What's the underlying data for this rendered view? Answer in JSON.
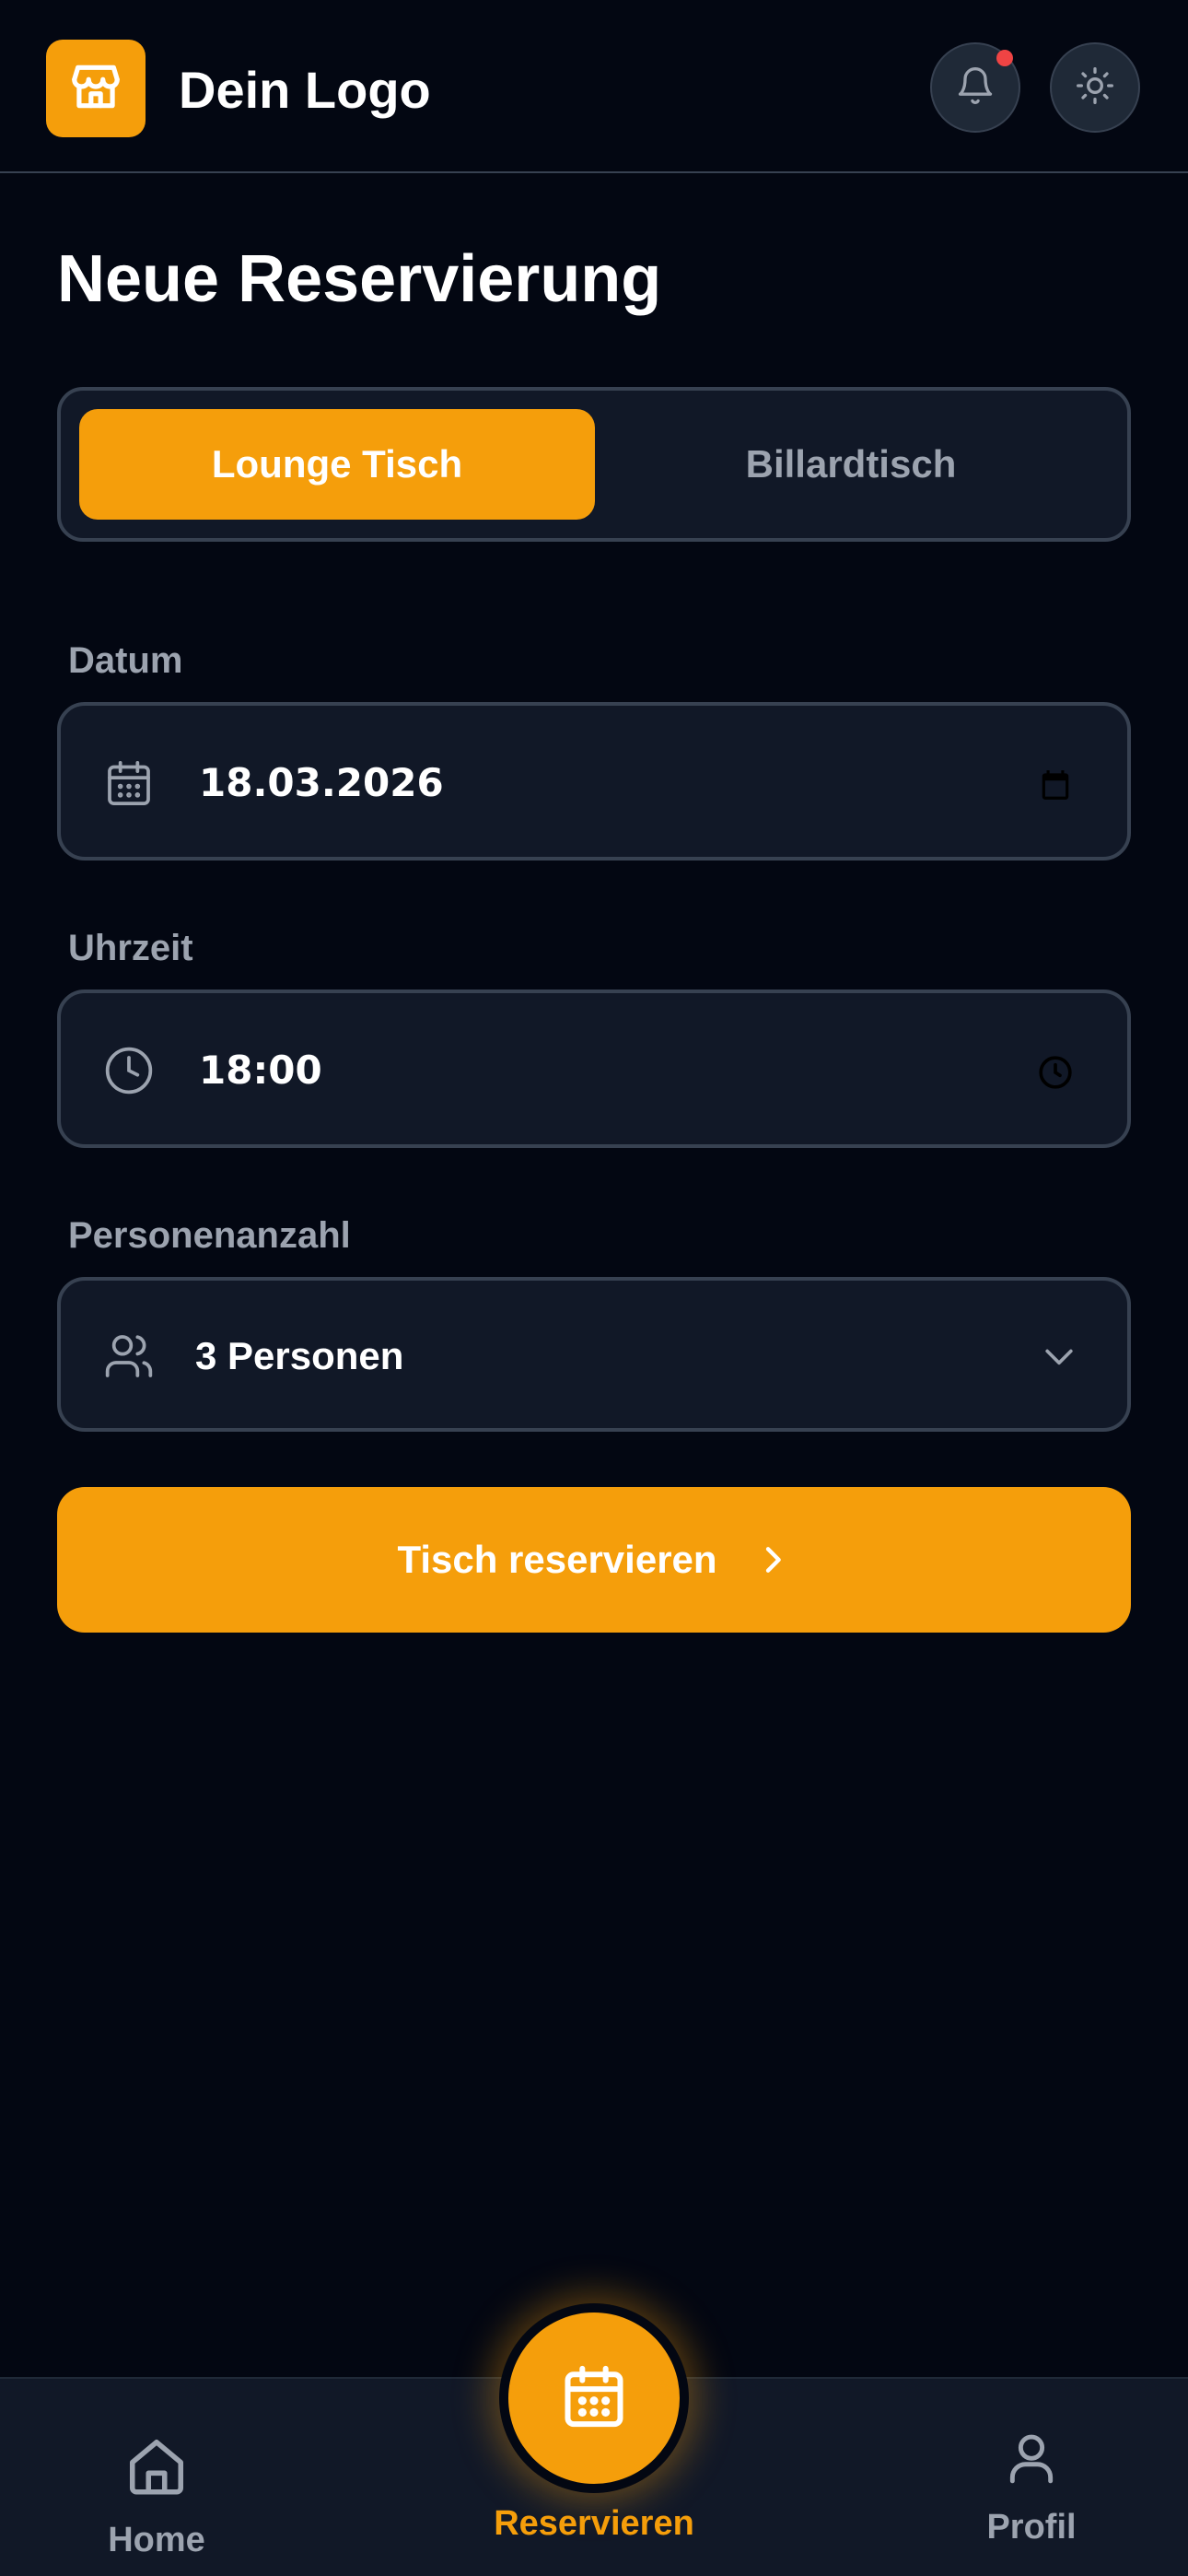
{
  "header": {
    "logo_text": "Dein Logo",
    "logo_icon": "store-icon",
    "notification_icon": "bell-icon",
    "theme_icon": "sun-icon",
    "has_notification": true
  },
  "page": {
    "title": "Neue Reservierung"
  },
  "table_type": {
    "options": [
      "Lounge Tisch",
      "Billardtisch"
    ],
    "selected": "Lounge Tisch"
  },
  "form": {
    "date": {
      "label": "Datum",
      "value": "18.03.2026",
      "icon": "calendar-icon"
    },
    "time": {
      "label": "Uhrzeit",
      "value": "18:00",
      "icon": "clock-icon"
    },
    "guests": {
      "label": "Personenanzahl",
      "value": "3 Personen",
      "icon": "users-icon"
    },
    "submit_label": "Tisch reservieren"
  },
  "nav": {
    "home_label": "Home",
    "reserve_label": "Reservieren",
    "profile_label": "Profil",
    "active": "Reservieren"
  },
  "colors": {
    "accent": "#f59e0b",
    "background": "#030712",
    "surface": "#111827",
    "border": "#374151",
    "muted_text": "#9ca3af",
    "notification": "#ef4444"
  }
}
